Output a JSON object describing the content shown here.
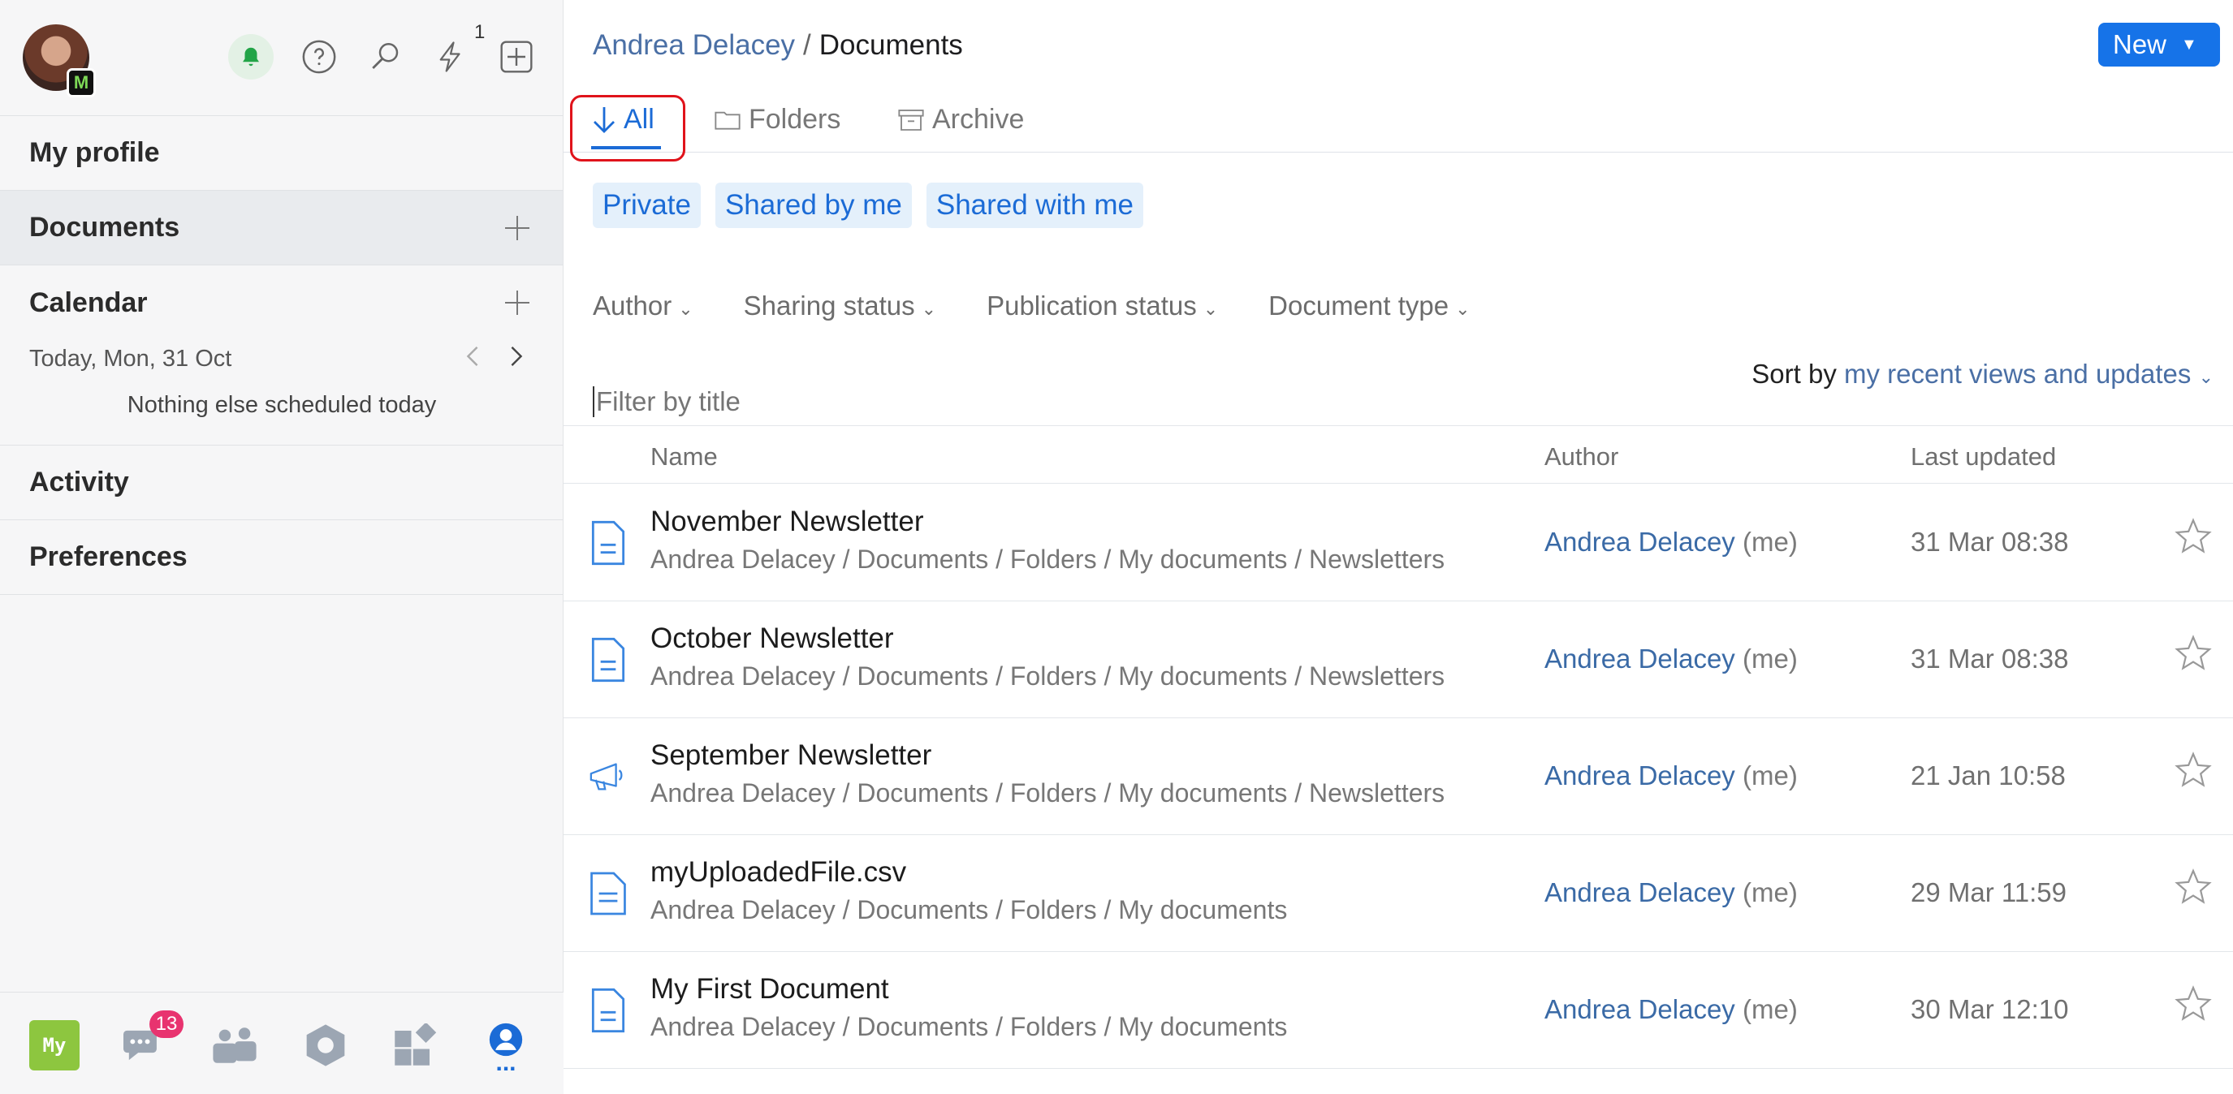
{
  "topbar": {
    "bolt_count": "1"
  },
  "sidebar": {
    "items": [
      {
        "label": "My profile"
      },
      {
        "label": "Documents"
      },
      {
        "label": "Calendar"
      },
      {
        "label": "Activity"
      },
      {
        "label": "Preferences"
      }
    ],
    "calendar": {
      "date": "Today, Mon, 31 Oct",
      "empty_text": "Nothing else scheduled today"
    }
  },
  "bottombar": {
    "my_label": "My",
    "chat_badge": "13",
    "more_label": "..."
  },
  "header": {
    "breadcrumb_root": "Andrea Delacey",
    "breadcrumb_sep": "/",
    "breadcrumb_current": "Documents",
    "new_label": "New"
  },
  "tabs": [
    {
      "label": "All"
    },
    {
      "label": "Folders"
    },
    {
      "label": "Archive"
    }
  ],
  "chips": [
    "Private",
    "Shared by me",
    "Shared with me"
  ],
  "filters": [
    "Author",
    "Sharing status",
    "Publication status",
    "Document type"
  ],
  "sort": {
    "prefix": "Sort by",
    "value": "my recent views and updates"
  },
  "search": {
    "placeholder": "Filter by title"
  },
  "table": {
    "columns": {
      "name": "Name",
      "author": "Author",
      "updated": "Last updated"
    },
    "rows": [
      {
        "title": "November Newsletter",
        "path": "Andrea Delacey / Documents / Folders / My documents / Newsletters",
        "author": "Andrea Delacey",
        "author_suffix": "(me)",
        "updated": "31 Mar 08:38",
        "icon": "document-icon"
      },
      {
        "title": "October Newsletter",
        "path": "Andrea Delacey / Documents / Folders / My documents / Newsletters",
        "author": "Andrea Delacey",
        "author_suffix": "(me)",
        "updated": "31 Mar 08:38",
        "icon": "document-icon"
      },
      {
        "title": "September Newsletter",
        "path": "Andrea Delacey / Documents / Folders / My documents / Newsletters",
        "author": "Andrea Delacey",
        "author_suffix": "(me)",
        "updated": "21 Jan 10:58",
        "icon": "megaphone-icon"
      },
      {
        "title": "myUploadedFile.csv",
        "path": "Andrea Delacey / Documents / Folders / My documents",
        "author": "Andrea Delacey",
        "author_suffix": "(me)",
        "updated": "29 Mar 11:59",
        "icon": "file-icon"
      },
      {
        "title": "My First Document",
        "path": "Andrea Delacey / Documents / Folders / My documents",
        "author": "Andrea Delacey",
        "author_suffix": "(me)",
        "updated": "30 Mar 12:10",
        "icon": "document-icon"
      }
    ]
  },
  "colors": {
    "accent": "#1b6bd6",
    "link": "#4a6fa5",
    "new_button": "#1673e8",
    "highlight": "#e0131b",
    "chat_badge": "#e8336f",
    "my_tile": "#8dc63f"
  }
}
